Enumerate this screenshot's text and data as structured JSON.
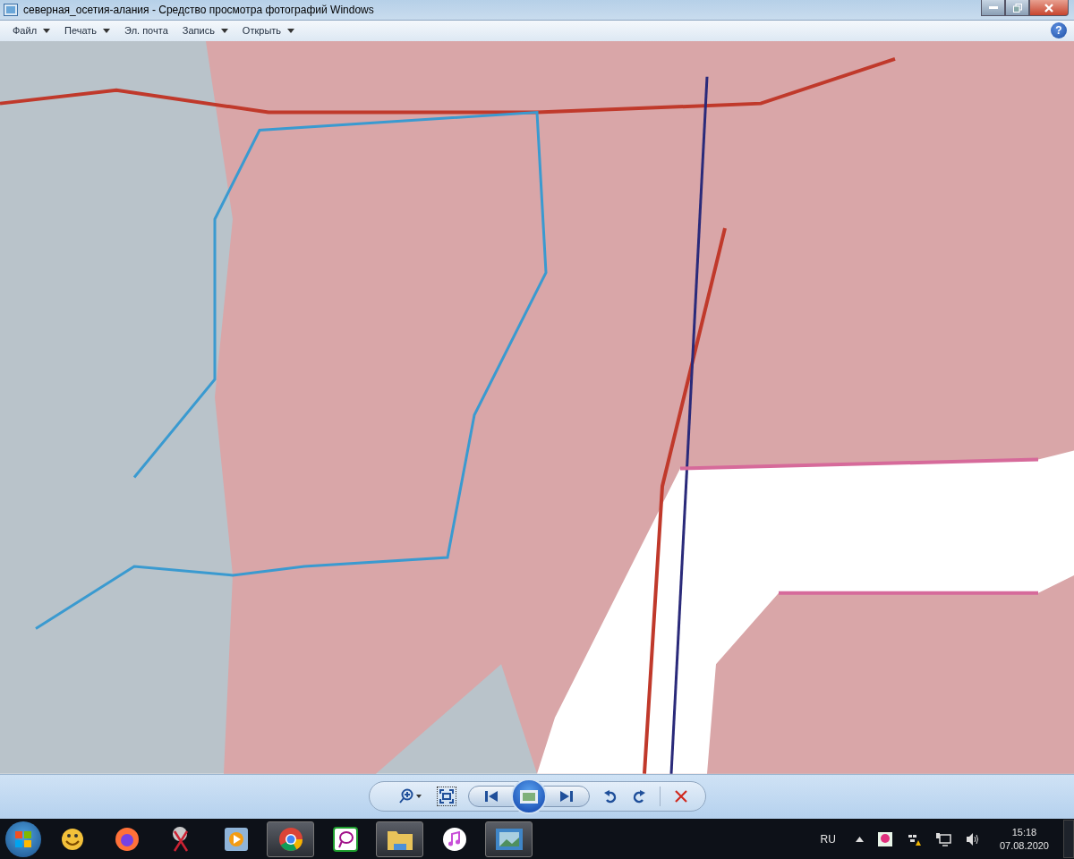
{
  "window": {
    "title": "северная_осетия-алания - Средство просмотра фотографий Windows"
  },
  "menu": [
    {
      "label": "Файл",
      "dropdown": true
    },
    {
      "label": "Печать",
      "dropdown": true
    },
    {
      "label": "Эл. почта",
      "dropdown": false
    },
    {
      "label": "Запись",
      "dropdown": true
    },
    {
      "label": "Открыть",
      "dropdown": true
    }
  ],
  "help": "?",
  "taskbar": {
    "apps": [
      {
        "kind": "smiley",
        "running": false
      },
      {
        "kind": "firefox",
        "running": false
      },
      {
        "kind": "scissors",
        "running": false
      },
      {
        "kind": "player",
        "running": false
      },
      {
        "kind": "chrome",
        "running": true
      },
      {
        "kind": "chat",
        "running": false
      },
      {
        "kind": "folder",
        "running": true
      },
      {
        "kind": "music",
        "running": false
      },
      {
        "kind": "photo",
        "running": true
      }
    ],
    "language": "RU",
    "time": "15:18",
    "date": "07.08.2020"
  }
}
